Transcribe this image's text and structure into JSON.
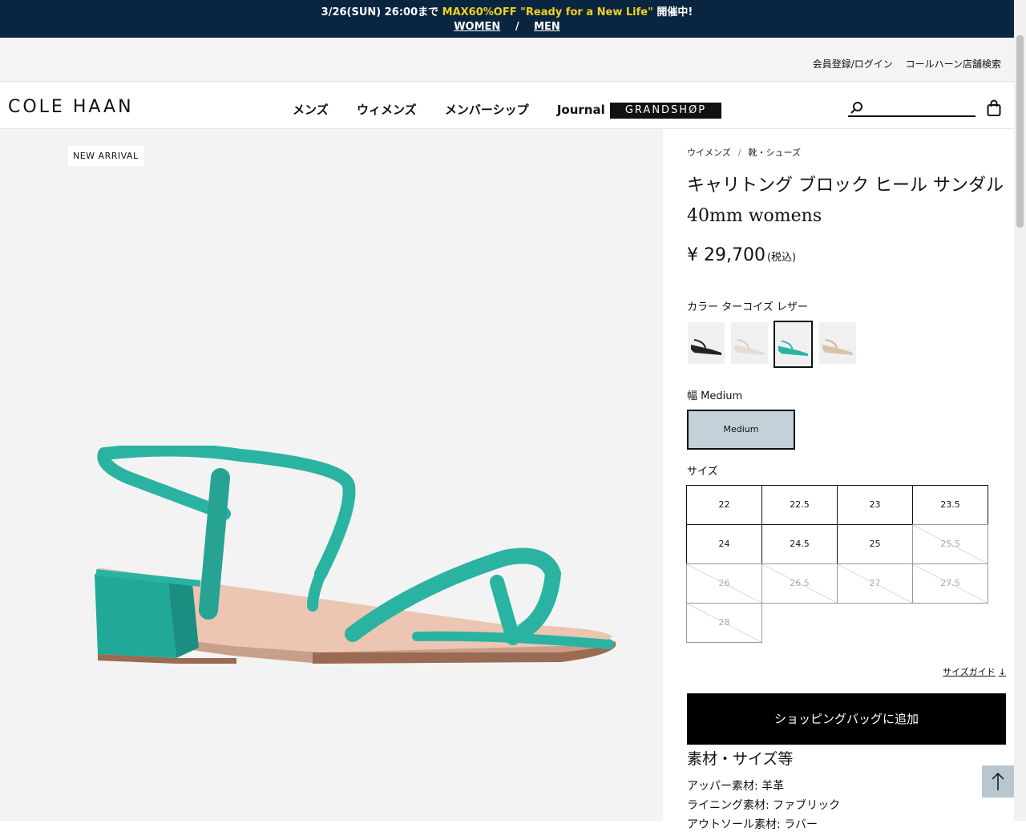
{
  "promo": {
    "prefix": "3/26(SUN) 26:00まで ",
    "highlight": "MAX60%OFF \"Ready for a New Life\"",
    "suffix": " 開催中!",
    "link_women": "WOMEN",
    "separator": "/",
    "link_men": "MEN"
  },
  "utility": {
    "login": "会員登録/ログイン",
    "store_search": "コールハーン店舗検索"
  },
  "header": {
    "logo": "COLE HAAN",
    "nav": [
      "メンズ",
      "ウィメンズ",
      "メンバーシップ",
      "Journal"
    ],
    "grandshop": "GRANDSHØP",
    "search_placeholder": ""
  },
  "product_image": {
    "badge": "NEW ARRIVAL",
    "color": "#2bb3a2"
  },
  "product": {
    "breadcrumb": [
      "ウイメンズ",
      "靴・シューズ"
    ],
    "breadcrumb_sep": "/",
    "title_line1": "キャリトング ブロック ヒール サンダル",
    "title_line2": "40mm womens",
    "price": "¥ 29,700",
    "tax": "(税込)",
    "color_label": "カラー ターコイズ レザー",
    "swatches": [
      {
        "name": "black",
        "color": "#222222"
      },
      {
        "name": "white",
        "color": "#e9e2d8"
      },
      {
        "name": "turquoise",
        "color": "#2bb3a2",
        "selected": true
      },
      {
        "name": "beige",
        "color": "#d9c3a8"
      }
    ],
    "width_label": "幅 Medium",
    "width_option": "Medium",
    "size_label": "サイズ",
    "sizes": [
      {
        "label": "22",
        "available": true
      },
      {
        "label": "22.5",
        "available": true
      },
      {
        "label": "23",
        "available": true
      },
      {
        "label": "23.5",
        "available": true
      },
      {
        "label": "24",
        "available": true
      },
      {
        "label": "24.5",
        "available": true
      },
      {
        "label": "25",
        "available": true
      },
      {
        "label": "25.5",
        "available": false
      },
      {
        "label": "26",
        "available": false
      },
      {
        "label": "26.5",
        "available": false
      },
      {
        "label": "27",
        "available": false
      },
      {
        "label": "27.5",
        "available": false
      },
      {
        "label": "28",
        "available": false
      }
    ],
    "size_guide": "サイズガイド",
    "size_guide_arrow": "↓",
    "add_to_bag": "ショッピングバッグに追加",
    "materials_heading": "素材・サイズ等",
    "materials": [
      "アッパー素材: 羊革",
      "ライニング素材: ファブリック",
      "アウトソール素材: ラバー"
    ]
  },
  "back_to_top": "↑"
}
